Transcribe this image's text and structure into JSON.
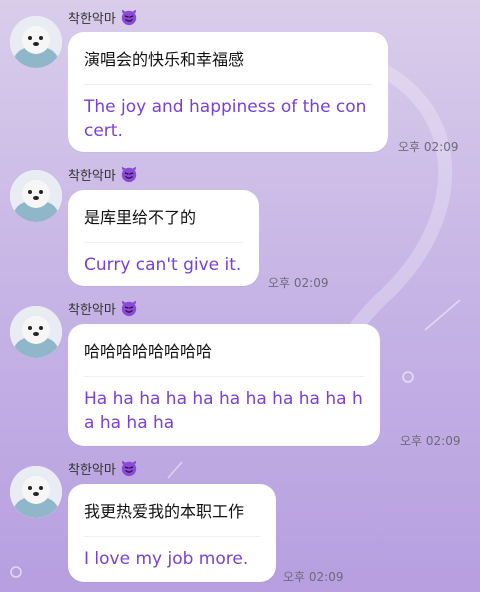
{
  "chat": {
    "messages": [
      {
        "sender": "착한악마",
        "sender_emoji": "smiling-devil",
        "original": "演唱会的快乐和幸福感",
        "translation": "The joy and happiness of the concert.",
        "time": "오후 02:09"
      },
      {
        "sender": "착한악마",
        "sender_emoji": "smiling-devil",
        "original": "是库里给不了的",
        "translation": "Curry can't give it.",
        "time": "오후 02:09"
      },
      {
        "sender": "착한악마",
        "sender_emoji": "smiling-devil",
        "original": "哈哈哈哈哈哈哈哈",
        "translation": "Ha ha ha ha ha ha ha ha ha ha ha ha ha ha",
        "time": "오후 02:09"
      },
      {
        "sender": "착한악마",
        "sender_emoji": "smiling-devil",
        "original": "我更热爱我的本职工作",
        "translation": "I love my job more.",
        "time": "오후 02:09"
      }
    ]
  },
  "colors": {
    "translation_text": "#7a3fd6",
    "bubble": "#ffffff",
    "background_top": "#d9cdea",
    "background_bottom": "#b79fe0"
  }
}
